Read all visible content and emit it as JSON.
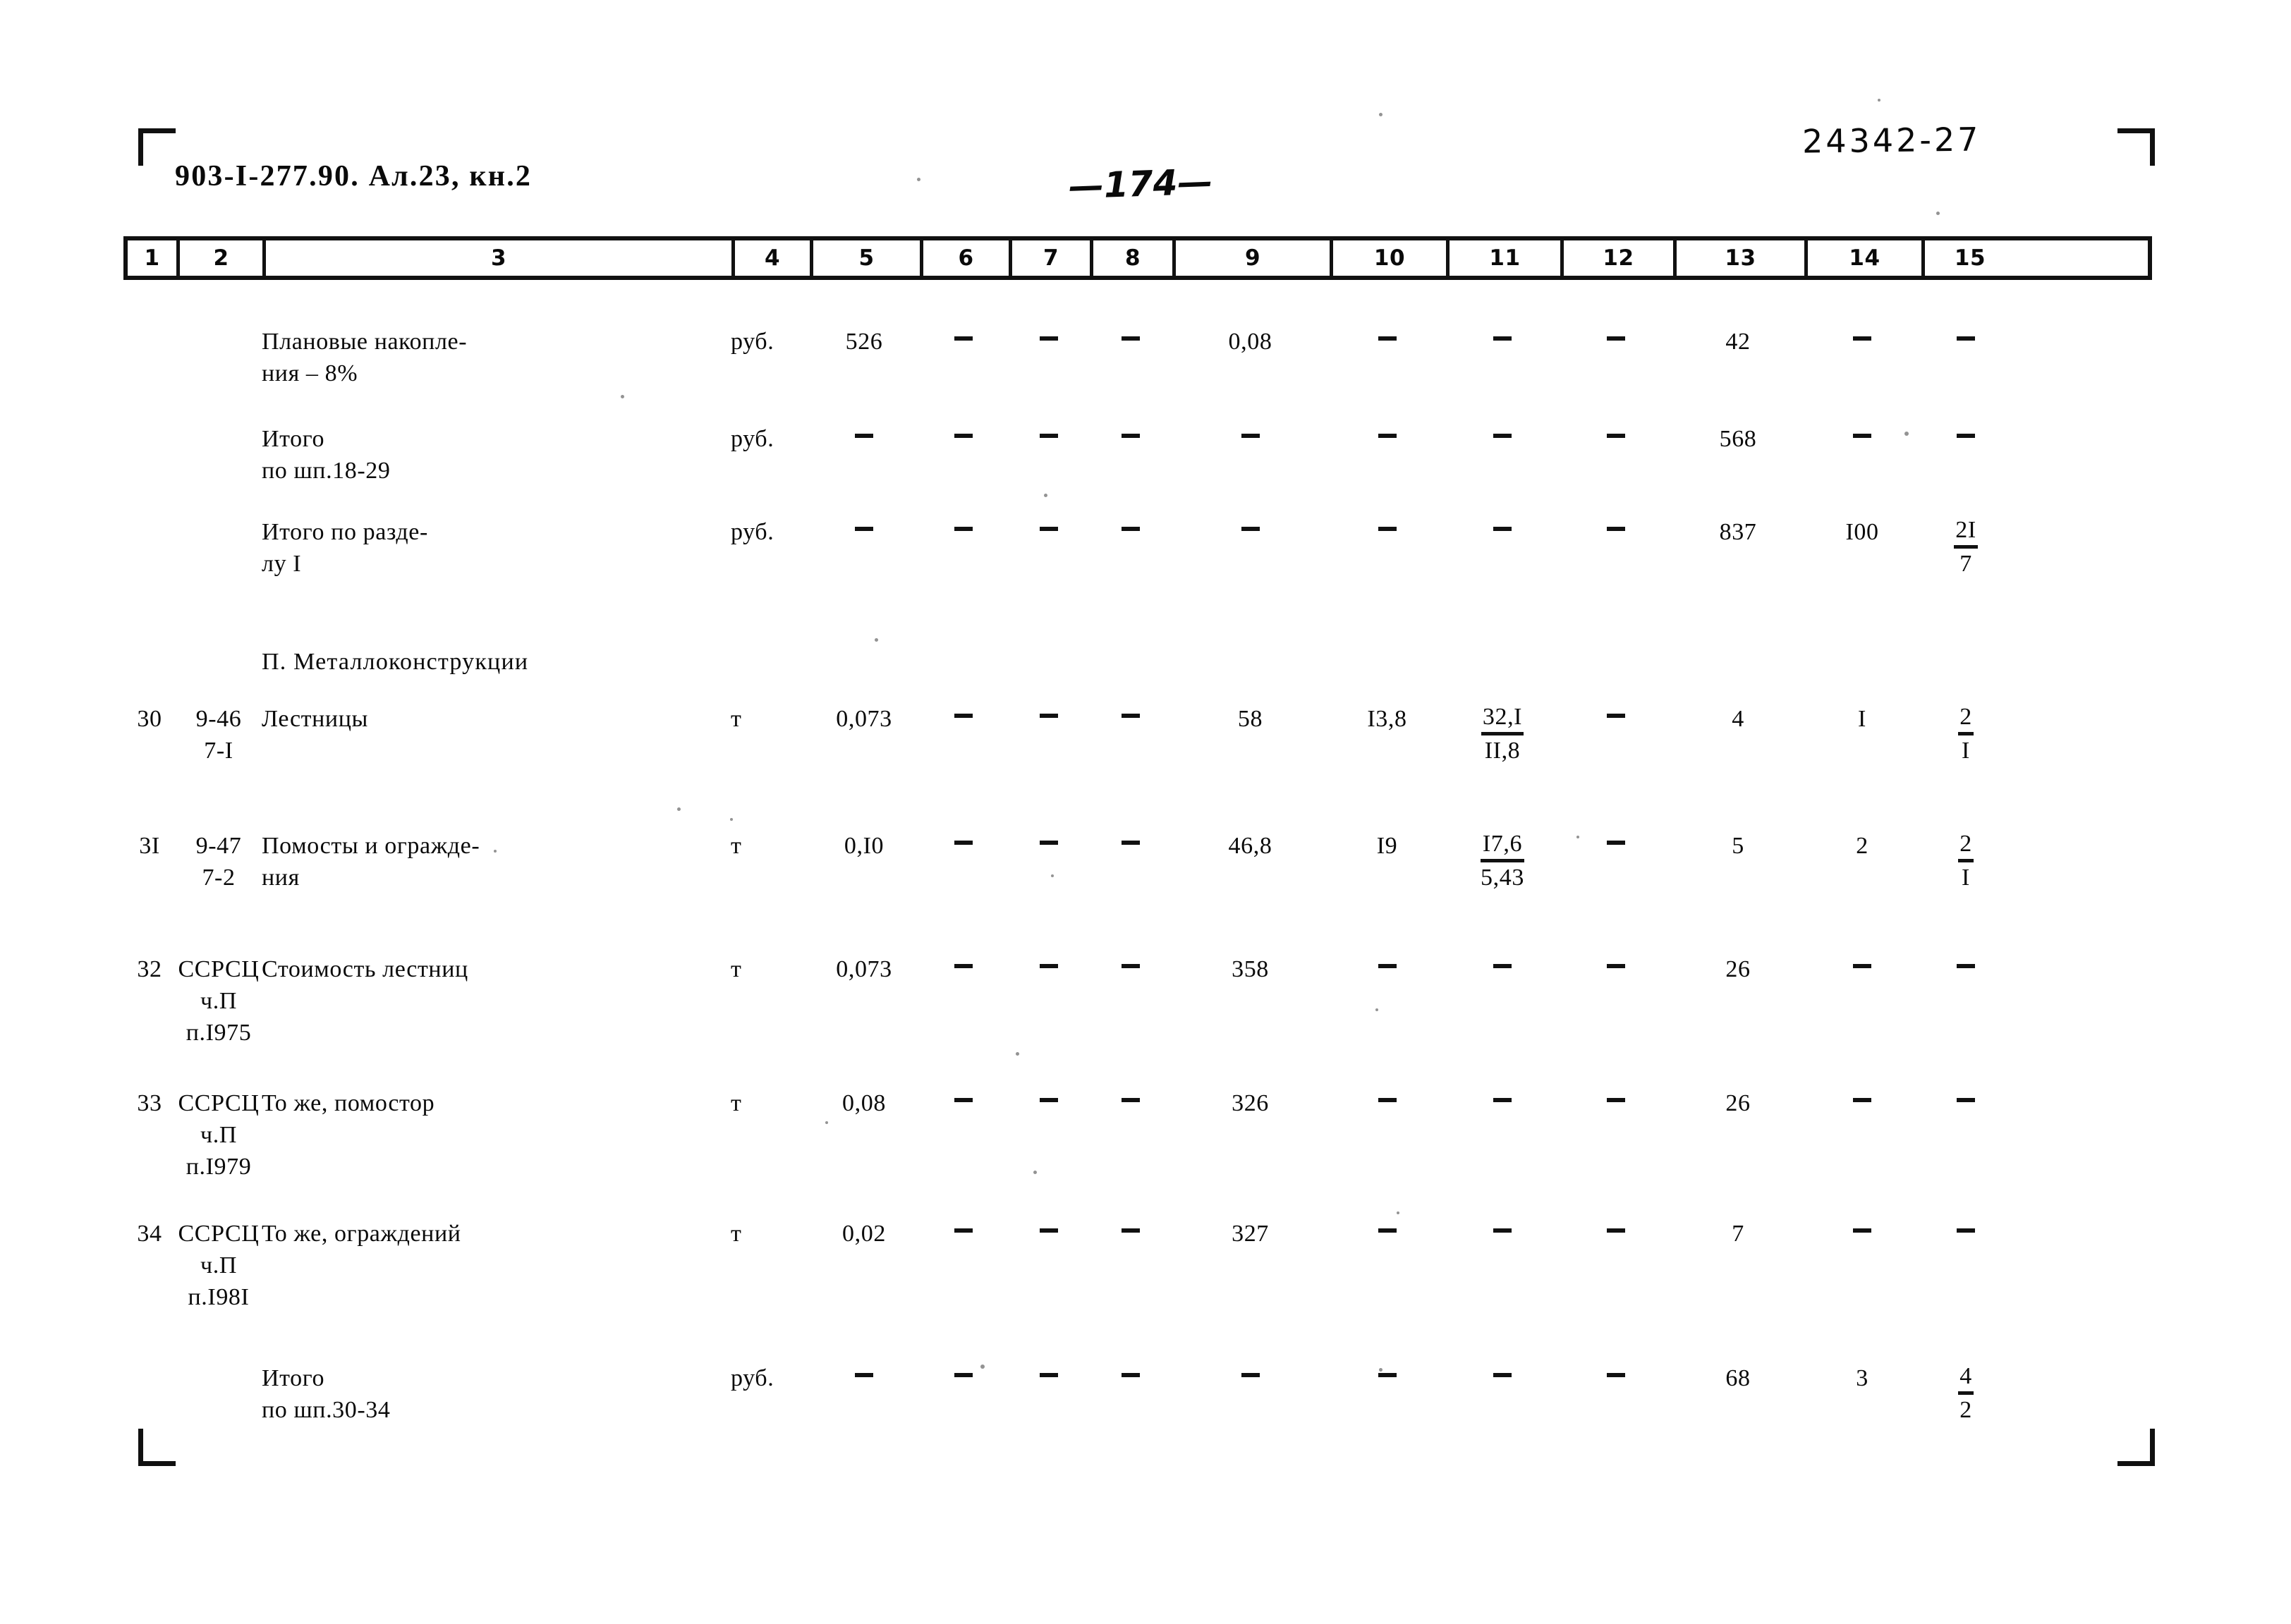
{
  "header": {
    "doc_code": "903-I-277.90. Ал.23, кн.2",
    "archive_number": "24342-27",
    "page_number": "—174—"
  },
  "table": {
    "column_numbers": [
      "1",
      "2",
      "3",
      "4",
      "5",
      "6",
      "7",
      "8",
      "9",
      "10",
      "11",
      "12",
      "13",
      "14",
      "15"
    ],
    "rows": [
      {
        "kind": "data",
        "c1": "",
        "c2": "",
        "c3": "Плановые накопле-\nния – 8%",
        "c4": "руб.",
        "c5": "526",
        "c6": "–",
        "c7": "–",
        "c8": "–",
        "c9": "0,08",
        "c10": "–",
        "c11": "–",
        "c12": "–",
        "c13": "42",
        "c14": "–",
        "c15": "–"
      },
      {
        "kind": "data",
        "c1": "",
        "c2": "",
        "c3": "Итого\nпо шп.18-29",
        "c4": "руб.",
        "c5": "–",
        "c6": "–",
        "c7": "–",
        "c8": "–",
        "c9": "–",
        "c10": "–",
        "c11": "–",
        "c12": "–",
        "c13": "568",
        "c14": "–",
        "c15": "–"
      },
      {
        "kind": "data",
        "c1": "",
        "c2": "",
        "c3": "Итого по разде-\nлу I",
        "c4": "руб.",
        "c5": "–",
        "c6": "–",
        "c7": "–",
        "c8": "–",
        "c9": "–",
        "c10": "–",
        "c11": "–",
        "c12": "–",
        "c13": "837",
        "c14": "I00",
        "c15_frac": {
          "top": "2I",
          "bottom": "7"
        }
      },
      {
        "kind": "section",
        "title": "П. Металлоконструкции"
      },
      {
        "kind": "data",
        "c1": "30",
        "c2": "9-46\n7-I",
        "c3": "Лестницы",
        "c4": "т",
        "c5": "0,073",
        "c6": "–",
        "c7": "–",
        "c8": "–",
        "c9": "58",
        "c10": "I3,8",
        "c11_frac": {
          "top": "32,I",
          "bottom": "II,8"
        },
        "c12": "–",
        "c13": "4",
        "c14": "I",
        "c15_frac": {
          "top": "2",
          "bottom": "I"
        }
      },
      {
        "kind": "data",
        "c1": "3I",
        "c2": "9-47\n7-2",
        "c3": "Помосты и огражде-\nния",
        "c4": "т",
        "c5": "0,I0",
        "c6": "–",
        "c7": "–",
        "c8": "–",
        "c9": "46,8",
        "c10": "I9",
        "c11_frac": {
          "top": "I7,6",
          "bottom": "5,43"
        },
        "c12": "–",
        "c13": "5",
        "c14": "2",
        "c15_frac": {
          "top": "2",
          "bottom": "I"
        }
      },
      {
        "kind": "data",
        "c1": "32",
        "c2": "ССРСЦ\nч.П\nп.I975",
        "c3": "Стоимость лестниц",
        "c4": "т",
        "c5": "0,073",
        "c6": "–",
        "c7": "–",
        "c8": "–",
        "c9": "358",
        "c10": "–",
        "c11": "–",
        "c12": "–",
        "c13": "26",
        "c14": "–",
        "c15": "–"
      },
      {
        "kind": "data",
        "c1": "33",
        "c2": "ССРСЦ\nч.П\nп.I979",
        "c3": "То же, помостор",
        "c4": "т",
        "c5": "0,08",
        "c6": "–",
        "c7": "–",
        "c8": "–",
        "c9": "326",
        "c10": "–",
        "c11": "–",
        "c12": "–",
        "c13": "26",
        "c14": "–",
        "c15": "–"
      },
      {
        "kind": "data",
        "c1": "34",
        "c2": "ССРСЦ\nч.П\nп.I98I",
        "c3": "То же, ограждений",
        "c4": "т",
        "c5": "0,02",
        "c6": "–",
        "c7": "–",
        "c8": "–",
        "c9": "327",
        "c10": "–",
        "c11": "–",
        "c12": "–",
        "c13": "7",
        "c14": "–",
        "c15": "–"
      },
      {
        "kind": "data",
        "c1": "",
        "c2": "",
        "c3": "Итого\nпо шп.30-34",
        "c4": "руб.",
        "c5": "–",
        "c6": "–",
        "c7": "–",
        "c8": "–",
        "c9": "–",
        "c10": "–",
        "c11": "–",
        "c12": "–",
        "c13": "68",
        "c14": "3",
        "c15_frac": {
          "top": "4",
          "bottom": "2"
        }
      }
    ]
  }
}
